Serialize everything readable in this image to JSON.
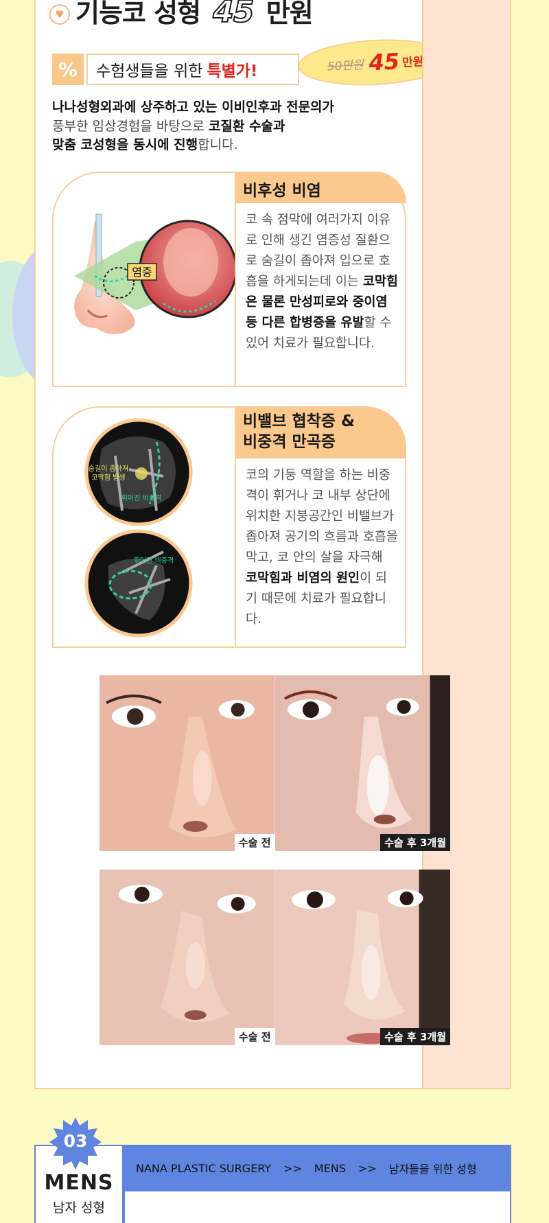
{
  "section": {
    "title_prefix": "기능코 성형",
    "title_price": "45",
    "title_suffix": "만원"
  },
  "offer": {
    "percent_icon": "%",
    "label": "수험생들을 위한",
    "highlight": "특별가!",
    "old_price": "50만원",
    "new_price": "45",
    "new_price_unit": "만원"
  },
  "intro": {
    "line1": "나나성형외과에 상주하고 있는 이비인후과 전문의가",
    "line2_a": "풍부한 임상경험을 바탕으로",
    "line2_b": "코질환 수술과",
    "line3_a": "맞춤 코성형을 동시에 진행",
    "line3_b": "합니다."
  },
  "cards": [
    {
      "heading": "비후성 비염",
      "image_label": "염증",
      "body_a": "코 속 점막에 여러가지 이유로 인해 생긴 염증성 질환으로 숨길이 좁아져 입으로 호흡을 하게되는데 이는",
      "body_b": "코막힘은 물론 만성피로와 중이염 등 다른 합병증을 유발",
      "body_c": "할 수 있어 치료가 필요합니다."
    },
    {
      "heading_1": "비밸브 협착증 &",
      "heading_2": "비중격 만곡증",
      "scan1_label_a": "숨길이 좁아져",
      "scan1_label_b": "코막힘 발생",
      "scan1_label_c": "휘어진 비중격",
      "scan2_label": "휘어진 비중격",
      "body_a": "코의 기둥 역할을 하는 비중격이 휘거나 코 내부 상단에 위치한 지붕공간인 비밸브가 좁아져 공기의 흐름과 호흡을 막고, 코 안의 살을 자극해",
      "body_b": "코막힘과 비염의 원인",
      "body_c": "이 되기 때문에 치료가 필요합니다."
    }
  ],
  "photos": {
    "before_label": "수술 전",
    "after_label": "수술 후 3개월"
  },
  "mens": {
    "number": "03",
    "title": "MENS",
    "subtitle": "남자 성형",
    "breadcrumb": [
      "NANA PLASTIC SURGERY",
      ">>",
      "MENS",
      ">>",
      "남자들을 위한 성형"
    ]
  },
  "colors": {
    "page_bg": "#fdf9c3",
    "accent_orange": "#fbc98d",
    "accent_red": "#e2231a",
    "mens_blue": "#5f85e0"
  }
}
